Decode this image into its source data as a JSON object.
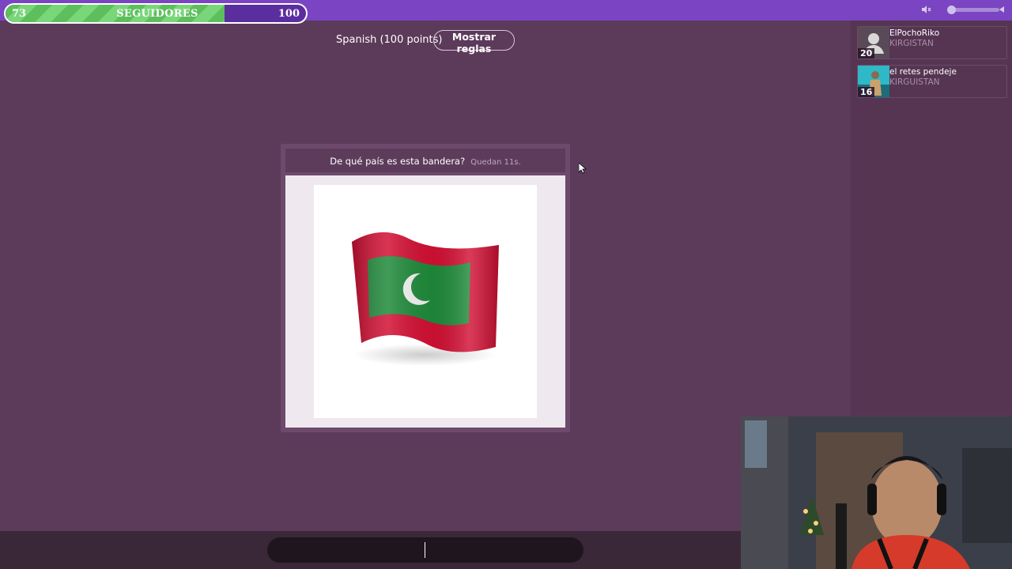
{
  "topbar": {
    "progress": {
      "min": "73",
      "max": "100",
      "label": "SEGUIDORES",
      "fraction": 0.73
    },
    "volume_level": 0.0
  },
  "game": {
    "language_info": "Spanish (100 points)",
    "rules_button": "Mostrar reglas",
    "question": "De qué país es esta bandera?",
    "timer": "Quedan 11s."
  },
  "players": [
    {
      "name": "ElPochoRiko",
      "country": "KIRGISTAN",
      "score": "20",
      "avatar": "default-avatar"
    },
    {
      "name": "el retes pendeje",
      "country": "KIRGUISTAN",
      "score": "16",
      "avatar": "photo-avatar"
    }
  ],
  "answer": {
    "value": ""
  },
  "colors": {
    "topbar": "#7a44c2",
    "background": "#5c3a5a",
    "progress_fill": "#5cbf5c",
    "flag_red": "#d21034",
    "flag_green": "#1f8a3a"
  }
}
